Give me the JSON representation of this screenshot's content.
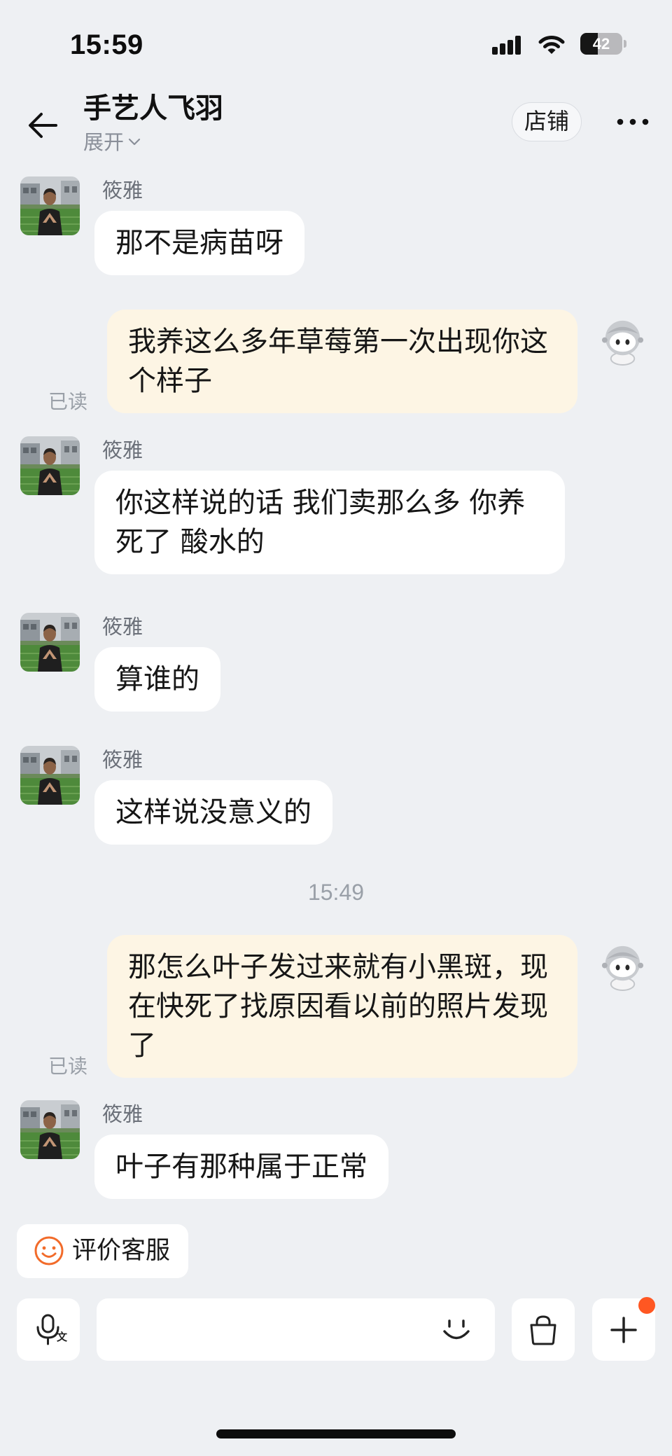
{
  "status_bar": {
    "time": "15:59",
    "battery_percent": "42"
  },
  "header": {
    "title": "手艺人飞羽",
    "expand_label": "展开",
    "store_button_label": "店铺"
  },
  "chat": {
    "messages": [
      {
        "own": false,
        "sender": "筱雅",
        "text": "那不是病苗呀"
      },
      {
        "own": true,
        "text": "我养这么多年草莓第一次出现你这个样子",
        "read_status": "已读"
      },
      {
        "own": false,
        "sender": "筱雅",
        "text": "你这样说的话 我们卖那么多 你养死了 酸水的"
      },
      {
        "own": false,
        "sender": "筱雅",
        "text": "算谁的"
      },
      {
        "own": false,
        "sender": "筱雅",
        "text": "这样说没意义的"
      },
      {
        "time_divider": "15:49"
      },
      {
        "own": true,
        "text": "那怎么叶子发过来就有小黑斑，现在快死了找原因看以前的照片发现了",
        "read_status": "已读"
      },
      {
        "own": false,
        "sender": "筱雅",
        "text": "叶子有那种属于正常"
      }
    ]
  },
  "rate_service": {
    "label": "评价客服"
  },
  "input_bar": {
    "voice_badge": "文"
  },
  "icons": {
    "back": "arrow-left-icon",
    "expand": "chevron-down-icon",
    "more": "more-horizontal-icon",
    "rate_service": "smiley-icon",
    "voice": "microphone-icon",
    "emoji": "emoji-icon",
    "shop": "shopping-bag-icon",
    "add": "plus-icon"
  },
  "colors": {
    "background": "#eef0f3",
    "incoming_bubble": "#ffffff",
    "own_bubble": "#fdf5e4",
    "accent": "#f26b2a",
    "badge_dot": "#ff5722",
    "muted_text": "#8a8f99"
  }
}
